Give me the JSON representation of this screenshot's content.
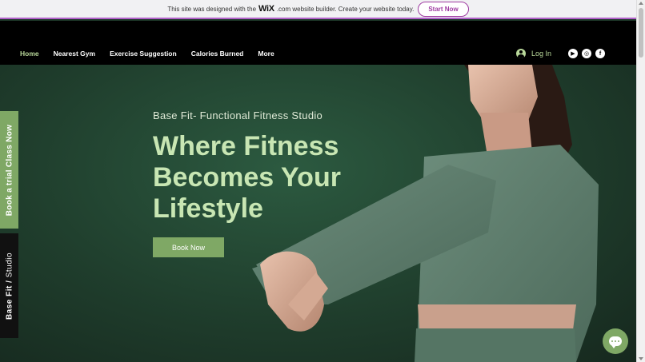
{
  "banner": {
    "text_before": "This site was designed with the",
    "wix": "WiX",
    "text_after": ".com website builder. Create your website today.",
    "cta": "Start Now"
  },
  "nav": {
    "items": [
      {
        "label": "Home",
        "active": true
      },
      {
        "label": "Nearest Gym",
        "active": false
      },
      {
        "label": "Exercise Suggestion",
        "active": false
      },
      {
        "label": "Calories Burned",
        "active": false
      },
      {
        "label": "More",
        "active": false
      }
    ],
    "login_label": "Log In",
    "social": [
      "youtube-icon",
      "instagram-icon",
      "facebook-icon"
    ]
  },
  "hero": {
    "subtitle": "Base Fit- Functional Fitness Studio",
    "headline_line1": "Where Fitness",
    "headline_line2": "Becomes Your",
    "headline_line3": "Lifestyle",
    "cta": "Book Now"
  },
  "side_tabs": {
    "trial": "Book a trial Class Now",
    "brand_bold": "Base Fit",
    "brand_sep": "/",
    "brand_light": "Studio"
  },
  "colors": {
    "accent": "#7fa865",
    "headline": "#c8e6b3",
    "banner_border": "#b160c9"
  }
}
